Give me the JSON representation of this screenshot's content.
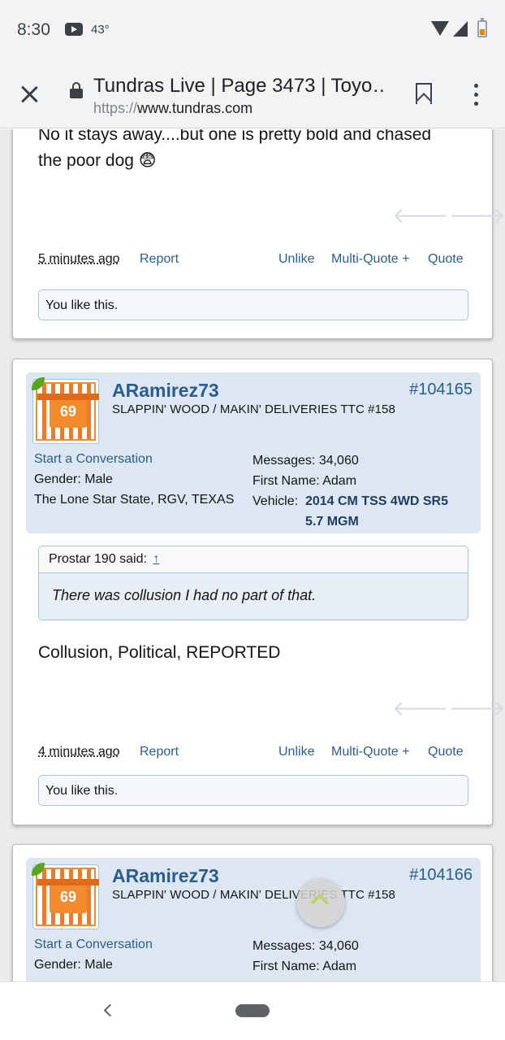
{
  "status_bar": {
    "time": "8:30",
    "temperature": "43°"
  },
  "browser": {
    "title": "Tundras Live | Page 3473 | Toyo…",
    "url_scheme": "https://",
    "url_host": "www.tundras.com"
  },
  "posts": [
    {
      "text_lines": [
        "No it stays away....but one is pretty bold and chased",
        "the poor dog 😨"
      ],
      "time": "5 minutes ago",
      "report": "Report",
      "unlike": "Unlike",
      "multi_quote": "Multi-Quote +",
      "quote": "Quote",
      "likes": "You like this."
    },
    {
      "username": "ARamirez73",
      "number": "#104165",
      "user_title": "SLAPPIN' WOOD / MAKIN' DELIVERIES TTC #158",
      "avatar_text": "69",
      "start_conversation": "Start a Conversation",
      "gender": "Gender:  Male",
      "location": "The Lone Star State, RGV, TEXAS",
      "messages": "Messages:  34,060",
      "first_name": "First Name:  Adam",
      "vehicle_label": "Vehicle:",
      "vehicle_line1": "2014 CM TSS 4WD SR5",
      "vehicle_line2": "5.7 MGM",
      "quote_author": "Prostar 190 said:",
      "quote_arrow": "↑",
      "quote_text": "There was collusion I had no part of that.",
      "text": "Collusion, Political, REPORTED",
      "time": "4 minutes ago",
      "report": "Report",
      "unlike": "Unlike",
      "multi_quote": "Multi-Quote +",
      "quote": "Quote",
      "likes": "You like this."
    },
    {
      "username": "ARamirez73",
      "number": "#104166",
      "user_title": "SLAPPIN' WOOD / MAKIN' DELIVERIES TTC #158",
      "avatar_text": "69",
      "start_conversation": "Start a Conversation",
      "gender": "Gender:  Male",
      "messages": "Messages:  34,060",
      "first_name": "First Name:  Adam"
    }
  ],
  "icons": {
    "close": "close-icon",
    "lock": "lock-icon",
    "bookmark": "bookmark-icon",
    "menu": "more-vertical-icon",
    "prev": "arrow-left-icon",
    "next": "arrow-right-icon",
    "scroll_top": "chevron-up-icon",
    "back": "back-icon"
  },
  "colors": {
    "link": "#2b5d8c",
    "user_card": "#dce7f2",
    "page_bg": "#ebebeb",
    "accent_leaf": "#5aa61e"
  }
}
